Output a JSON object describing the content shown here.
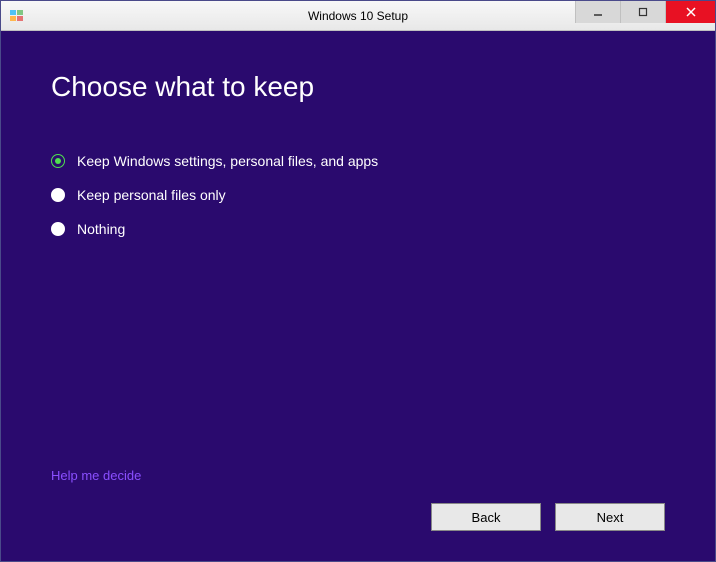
{
  "titlebar": {
    "title": "Windows 10 Setup"
  },
  "heading": "Choose what to keep",
  "options": [
    {
      "label": "Keep Windows settings, personal files, and apps",
      "selected": true
    },
    {
      "label": "Keep personal files only",
      "selected": false
    },
    {
      "label": "Nothing",
      "selected": false
    }
  ],
  "help_link": "Help me decide",
  "buttons": {
    "back": "Back",
    "next": "Next"
  }
}
